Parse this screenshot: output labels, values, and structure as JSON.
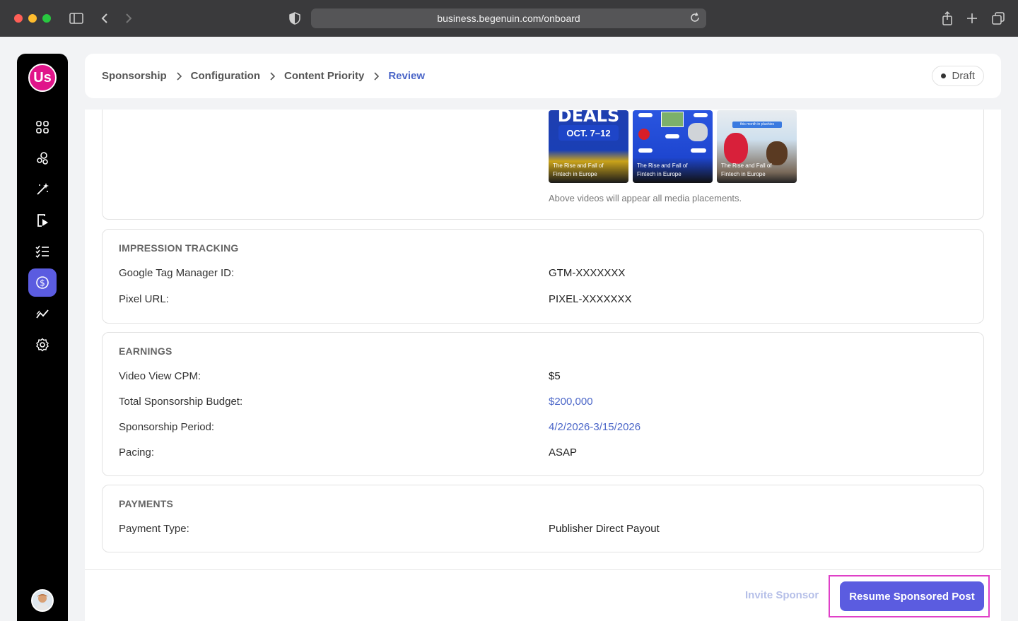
{
  "browser": {
    "url": "business.begenuin.com/onboard"
  },
  "sidebar": {
    "logo_text": "Us",
    "items": [
      {
        "icon": "grid-icon"
      },
      {
        "icon": "community-icon"
      },
      {
        "icon": "magic-wand-icon"
      },
      {
        "icon": "video-icon"
      },
      {
        "icon": "checklist-icon"
      },
      {
        "icon": "dollar-icon",
        "active": true
      },
      {
        "icon": "analytics-icon"
      },
      {
        "icon": "gear-icon"
      }
    ]
  },
  "breadcrumb": {
    "items": [
      "Sponsorship",
      "Configuration",
      "Content Priority",
      "Review"
    ],
    "status": "Draft"
  },
  "media": {
    "thumb1_headline": "DEALS",
    "thumb1_date": "OCT. 7–12",
    "thumb3_tag": "this month in plushies",
    "captions": [
      "The Rise and Fall of Fintech in Europe",
      "The Rise and Fall of Fintech in Europe",
      "The Rise and Fall of Fintech in Europe"
    ],
    "note": "Above videos will appear all media placements."
  },
  "impression": {
    "title": "IMPRESSION TRACKING",
    "gtm_label": "Google Tag Manager ID:",
    "gtm_value": "GTM-XXXXXXX",
    "pixel_label": "Pixel URL:",
    "pixel_value": "PIXEL-XXXXXXX"
  },
  "earnings": {
    "title": "EARNINGS",
    "cpm_label": "Video View CPM:",
    "cpm_value": "$5",
    "budget_label": "Total Sponsorship Budget:",
    "budget_value": "$200,000",
    "period_label": "Sponsorship Period:",
    "period_value": "4/2/2026-3/15/2026",
    "pacing_label": "Pacing:",
    "pacing_value": "ASAP"
  },
  "payments": {
    "title": "PAYMENTS",
    "type_label": "Payment Type:",
    "type_value": "Publisher Direct Payout"
  },
  "footer": {
    "invite_label": "Invite Sponsor",
    "resume_label": "Resume Sponsored Post"
  },
  "colors": {
    "accent": "#5b5ce0",
    "link": "#4b66c8",
    "brand": "#e0158a",
    "highlight": "#e040c8"
  }
}
